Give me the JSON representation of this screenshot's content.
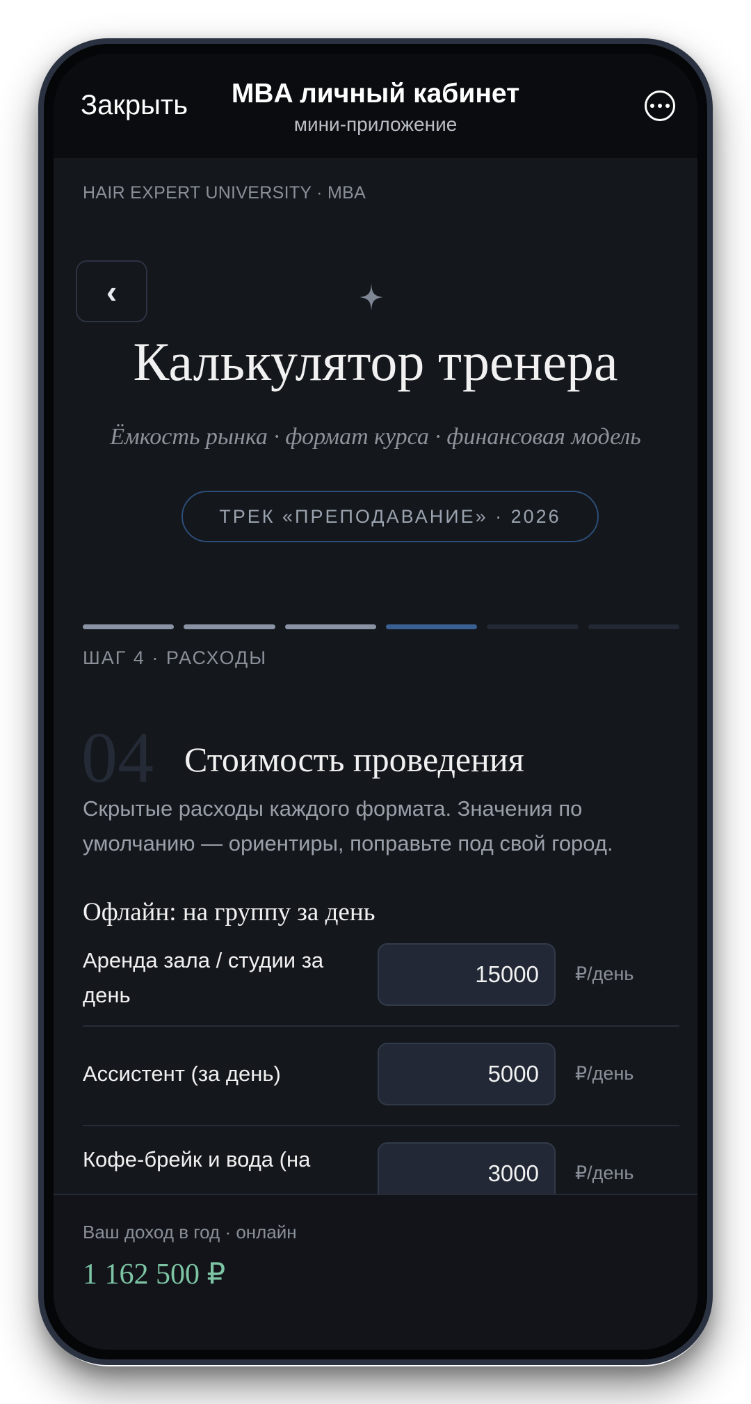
{
  "header": {
    "close_label": "Закрыть",
    "title": "MBA личный кабинет",
    "subtitle": "мини-приложение",
    "more_icon": "more-horizontal-icon"
  },
  "brand": "HAIR EXPERT UNIVERSITY · MBA",
  "hero": {
    "back_label": "‹",
    "title": "Калькулятор тренера",
    "subtitle": "Ёмкость рынка · формат курса · финансовая модель",
    "track": "ТРЕК «ПРЕПОДАВАНИЕ» · 2026"
  },
  "progress": {
    "current_step": 4,
    "total_steps": 6,
    "label": "ШАГ 4 · РАСХОДЫ",
    "colors": {
      "done": "#8a93a3",
      "current": "#3a5f91",
      "pending": "#222834"
    }
  },
  "section": {
    "number": "04",
    "title": "Стоимость проведения",
    "description": "Скрытые расходы каждого формата. Значения по умолчанию — ориентиры, поправьте под свой город."
  },
  "offline_group": {
    "title": "Офлайн: на группу за день",
    "rows": [
      {
        "label": "Аренда зала / студии за день",
        "value": "15000",
        "unit": "₽/день"
      },
      {
        "label": "Ассистент (за день)",
        "value": "5000",
        "unit": "₽/день"
      },
      {
        "label": "Кофе-брейк и вода (на",
        "value": "3000",
        "unit": "₽/день"
      }
    ]
  },
  "footer": {
    "label": "Ваш доход в год · онлайн",
    "value": "1 162 500 ₽",
    "accent": "#7dc4a4"
  }
}
